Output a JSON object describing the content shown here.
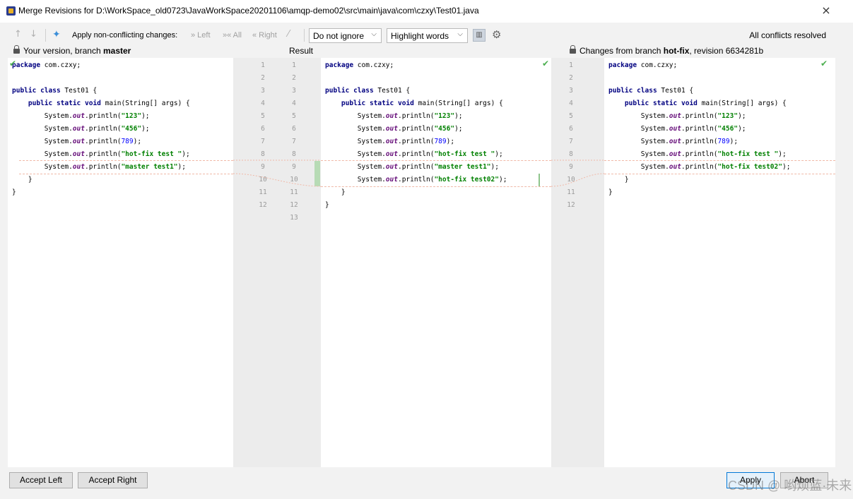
{
  "window": {
    "title": "Merge Revisions for D:\\WorkSpace_old0723\\JavaWorkSpace20201106\\amqp-demo02\\src\\main\\java\\com\\czxy\\Test01.java",
    "close_glyph": "×"
  },
  "toolbar": {
    "up_arrow": "↑",
    "down_arrow": "↓",
    "magic_icon": "✦",
    "apply_label": "Apply non-conflicting changes:",
    "left_label": "» Left",
    "all_label": "»« All",
    "right_label": "« Right",
    "wand_icon": "⁄",
    "ignore_dropdown": "Do not ignore",
    "highlight_dropdown": "Highlight words",
    "chevron": "⌵",
    "status": "All conflicts resolved"
  },
  "headers": {
    "left_prefix": "Your version, branch ",
    "left_branch": "master",
    "middle": "Result",
    "right_prefix": "Changes from branch ",
    "right_branch": "hot-fix",
    "right_suffix": ", revision 6634281b"
  },
  "left_lines": [
    "package com.czxy;",
    "",
    "public class Test01 {",
    "    public static void main(String[] args) {",
    "        System.out.println(\"123\");",
    "        System.out.println(\"456\");",
    "        System.out.println(789);",
    "        System.out.println(\"hot-fix test \");",
    "        System.out.println(\"master test1\");",
    "    }",
    "}",
    ""
  ],
  "result_lines": [
    "package com.czxy;",
    "",
    "public class Test01 {",
    "    public static void main(String[] args) {",
    "        System.out.println(\"123\");",
    "        System.out.println(\"456\");",
    "        System.out.println(789);",
    "        System.out.println(\"hot-fix test \");",
    "        System.out.println(\"master test1\");",
    "        System.out.println(\"hot-fix test02\");",
    "    }",
    "}",
    ""
  ],
  "right_lines": [
    "package com.czxy;",
    "",
    "public class Test01 {",
    "    public static void main(String[] args) {",
    "        System.out.println(\"123\");",
    "        System.out.println(\"456\");",
    "        System.out.println(789);",
    "        System.out.println(\"hot-fix test \");",
    "        System.out.println(\"hot-fix test02\");",
    "    }",
    "}",
    ""
  ],
  "left_line_numbers": [
    "1",
    "2",
    "3",
    "4",
    "5",
    "6",
    "7",
    "8",
    "9",
    "10",
    "11",
    "12"
  ],
  "result_line_numbers": [
    "1",
    "2",
    "3",
    "4",
    "5",
    "6",
    "7",
    "8",
    "9",
    "10",
    "11",
    "12",
    "13"
  ],
  "right_line_numbers": [
    "1",
    "2",
    "3",
    "4",
    "5",
    "6",
    "7",
    "8",
    "9",
    "10",
    "11",
    "12"
  ],
  "buttons": {
    "accept_left": "Accept Left",
    "accept_right": "Accept Right",
    "apply": "Apply",
    "abort": "Abort"
  },
  "watermark": "CSDN @ 哟烦蓝·未来",
  "colors": {
    "keyword": "#000080",
    "string": "#008000",
    "number": "#0000ff",
    "field": "#660e7a",
    "check": "#4caf50",
    "conflict_dash": "#f0b9a8"
  }
}
